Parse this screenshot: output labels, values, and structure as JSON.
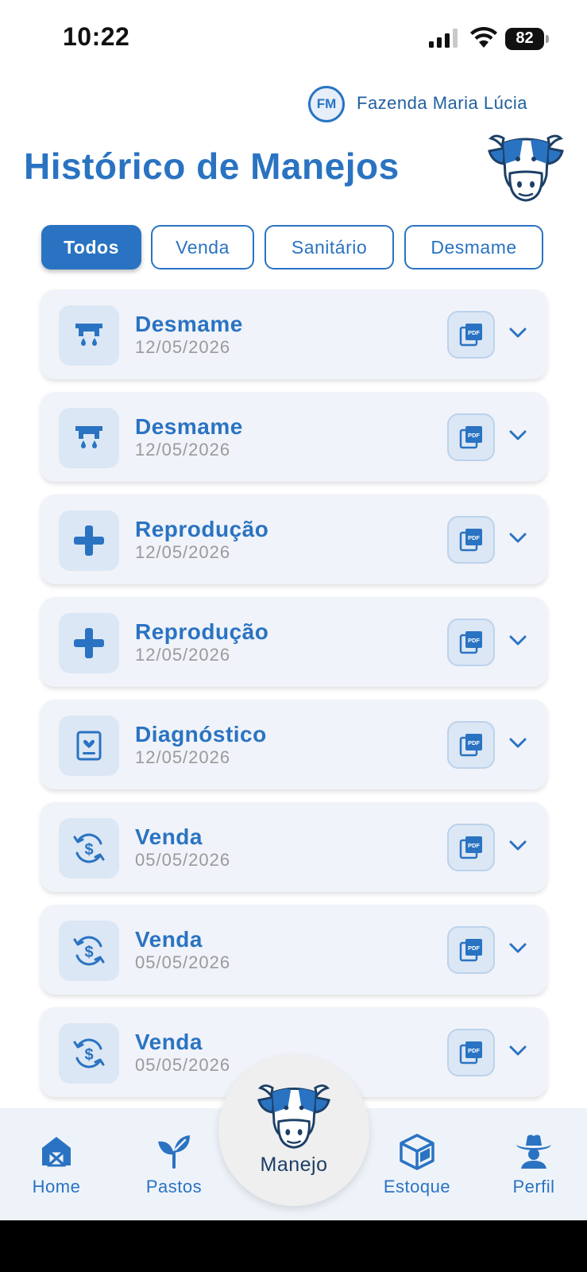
{
  "status_bar": {
    "time": "10:22",
    "battery": "82"
  },
  "header": {
    "farm_initials": "FM",
    "farm_name": "Fazenda Maria Lúcia",
    "title": "Histórico de Manejos"
  },
  "filters": [
    {
      "label": "Todos",
      "active": true
    },
    {
      "label": "Venda",
      "active": false
    },
    {
      "label": "Sanitário",
      "active": false
    },
    {
      "label": "Desmame",
      "active": false
    }
  ],
  "records": [
    {
      "type": "Desmame",
      "date": "12/05/2026",
      "icon": "udder-drops-icon"
    },
    {
      "type": "Desmame",
      "date": "12/05/2026",
      "icon": "udder-drops-icon"
    },
    {
      "type": "Reprodução",
      "date": "12/05/2026",
      "icon": "plus-icon"
    },
    {
      "type": "Reprodução",
      "date": "12/05/2026",
      "icon": "plus-icon"
    },
    {
      "type": "Diagnóstico",
      "date": "12/05/2026",
      "icon": "heart-report-icon"
    },
    {
      "type": "Venda",
      "date": "05/05/2026",
      "icon": "money-cycle-icon"
    },
    {
      "type": "Venda",
      "date": "05/05/2026",
      "icon": "money-cycle-icon"
    },
    {
      "type": "Venda",
      "date": "05/05/2026",
      "icon": "money-cycle-icon"
    }
  ],
  "bottom_nav": {
    "home": "Home",
    "pastos": "Pastos",
    "manejo": "Manejo",
    "estoque": "Estoque",
    "perfil": "Perfil"
  },
  "colors": {
    "primary": "#2a73c2",
    "card_bg": "#f0f3f9",
    "icon_bg": "#dce7f5",
    "date_gray": "#9a9a9a"
  }
}
